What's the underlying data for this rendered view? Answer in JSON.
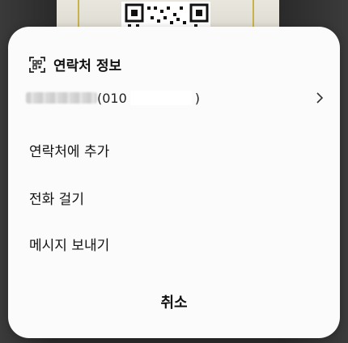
{
  "dialog": {
    "title": "연락처 정보",
    "title_icon": "qr-scan-icon",
    "contact": {
      "phone_prefix": "(010",
      "phone_suffix": ")"
    },
    "actions": [
      {
        "label": "연락처에 추가"
      },
      {
        "label": "전화 걸기"
      },
      {
        "label": "메시지 보내기"
      }
    ],
    "cancel_label": "취소"
  },
  "colors": {
    "sheet_bg": "#fbfbfb",
    "text": "#111111",
    "backdrop": "#2b2b2b"
  }
}
